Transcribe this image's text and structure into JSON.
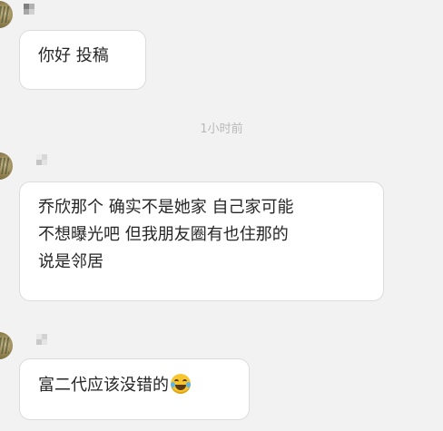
{
  "chat": {
    "timestamp": "1小时前",
    "messages": [
      {
        "avatar": "blurred-avatar",
        "lines": [
          "你好 投稿"
        ]
      },
      {
        "avatar": "blurred-avatar",
        "lines": [
          "乔欣那个 确实不是她家 自己家可能",
          "不想曝光吧 但我朋友圈有也住那的",
          "说是邻居"
        ]
      },
      {
        "avatar": "blurred-avatar",
        "lines": [
          "富二代应该没错的"
        ],
        "emoji": "tears-of-joy-emoji"
      }
    ]
  },
  "colors": {
    "background": "#f2f2f2",
    "bubble": "#ffffff",
    "bubble_border": "#dcdcdc",
    "text": "#262626",
    "timestamp": "#b9b9b9"
  }
}
